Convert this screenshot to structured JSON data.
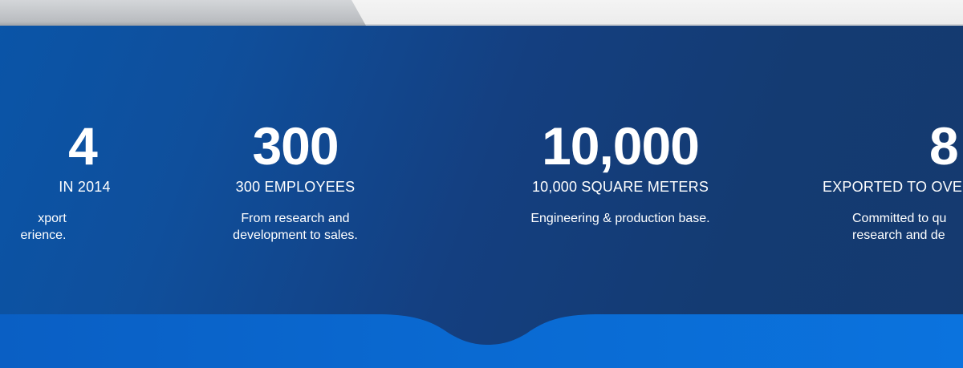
{
  "stats": [
    {
      "number": "4",
      "headline": "IN 2014",
      "description": "xport\nerience."
    },
    {
      "number": "300",
      "headline": "300 EMPLOYEES",
      "description": "From research and development to sales."
    },
    {
      "number": "10,000",
      "headline": "10,000 SQUARE METERS",
      "description": "Engineering & production base."
    },
    {
      "number": "8",
      "headline": "EXPORTED TO OVE",
      "description": "Committed to qu research and de"
    }
  ],
  "colors": {
    "background_start": "#0a55a8",
    "background_end": "#153a6f",
    "wave": "#0a6cd6",
    "text": "#ffffff"
  }
}
